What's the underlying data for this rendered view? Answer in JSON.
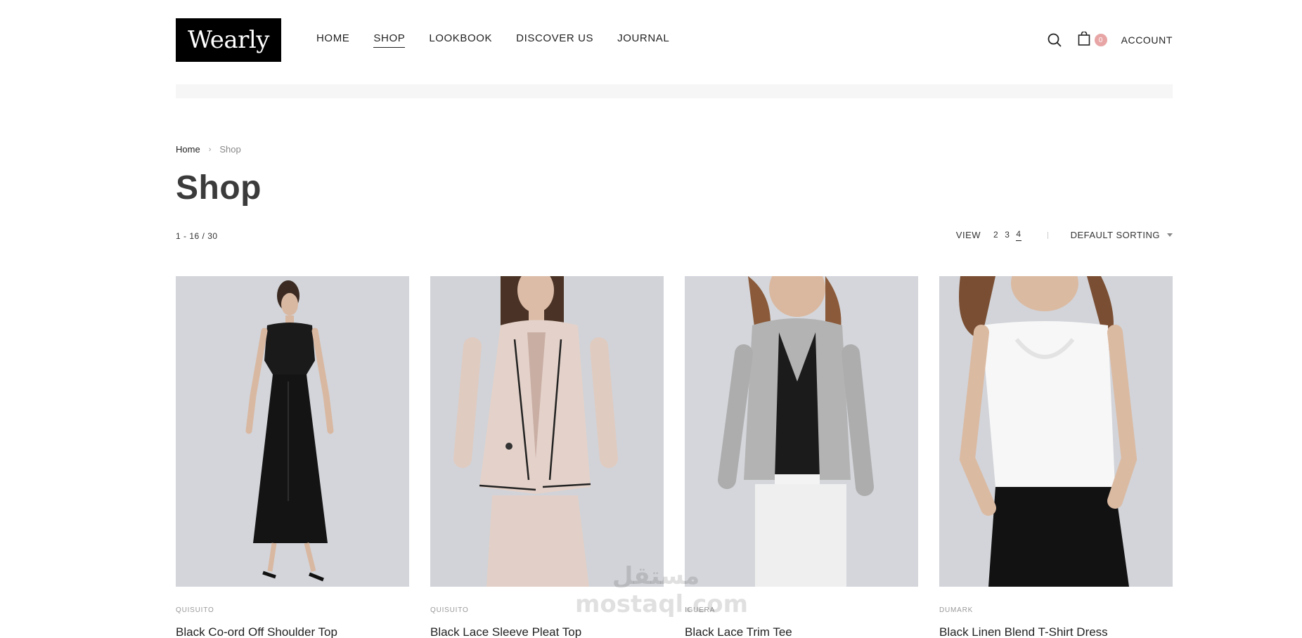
{
  "header": {
    "logo": "Wearly",
    "nav": [
      {
        "label": "HOME",
        "active": false
      },
      {
        "label": "SHOP",
        "active": true
      },
      {
        "label": "LOOKBOOK",
        "active": false
      },
      {
        "label": "DISCOVER US",
        "active": false
      },
      {
        "label": "JOURNAL",
        "active": false
      }
    ],
    "search_icon": "search-icon",
    "cart_icon": "shopping-bag-icon",
    "cart_count": "0",
    "account_label": "ACCOUNT"
  },
  "breadcrumb": {
    "home": "Home",
    "separator": "›",
    "current": "Shop"
  },
  "page_title": "Shop",
  "results_count": "1 - 16 / 30",
  "toolbar": {
    "view_label": "VIEW",
    "view_options": [
      "2",
      "3",
      "4"
    ],
    "active_view": "4",
    "divider": "|",
    "sorting_label": "DEFAULT SORTING"
  },
  "products": [
    {
      "brand": "QUISUITO",
      "name": "Black Co-ord Off Shoulder Top"
    },
    {
      "brand": "QUISUITO",
      "name": "Black Lace Sleeve Pleat Top"
    },
    {
      "brand": "IGUERA",
      "name": "Black Lace Trim Tee"
    },
    {
      "brand": "DUMARK",
      "name": "Black Linen Blend T-Shirt Dress"
    }
  ],
  "watermark": {
    "top": "مستقل",
    "bottom": "mostaql.com"
  },
  "colors": {
    "logo_bg": "#000000",
    "badge": "#e8a5a5",
    "image_bg": "#d2d4d9",
    "title": "#3b3b3b"
  }
}
